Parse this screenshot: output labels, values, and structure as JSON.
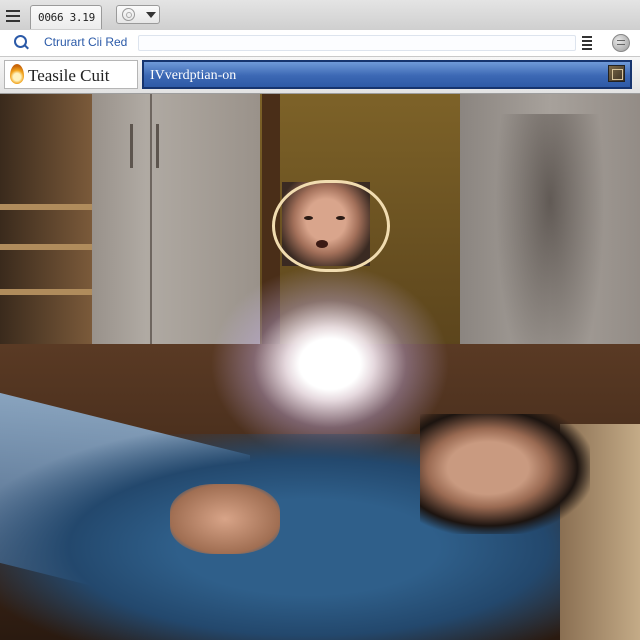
{
  "tabbar": {
    "tab_label": "0066 3.19"
  },
  "address": {
    "text": "Ctrurart Cii Red",
    "placeholder": ""
  },
  "title_row": {
    "site_name": "Teasile Cuit",
    "url": "IVverdptian-on"
  },
  "icons": {
    "menu": "hamburger-menu-icon",
    "tab_ring": "ring-icon",
    "tab_caret": "chevron-down-icon",
    "search": "search-icon",
    "list": "list-icon",
    "globe": "globe-icon",
    "logo": "flame-icon",
    "go": "go-icon"
  },
  "colors": {
    "accent_blue": "#2b5aa8",
    "url_bar_top": "#6f9ad8",
    "url_bar_bottom": "#2e5aa6",
    "url_bar_border": "#16346e"
  }
}
